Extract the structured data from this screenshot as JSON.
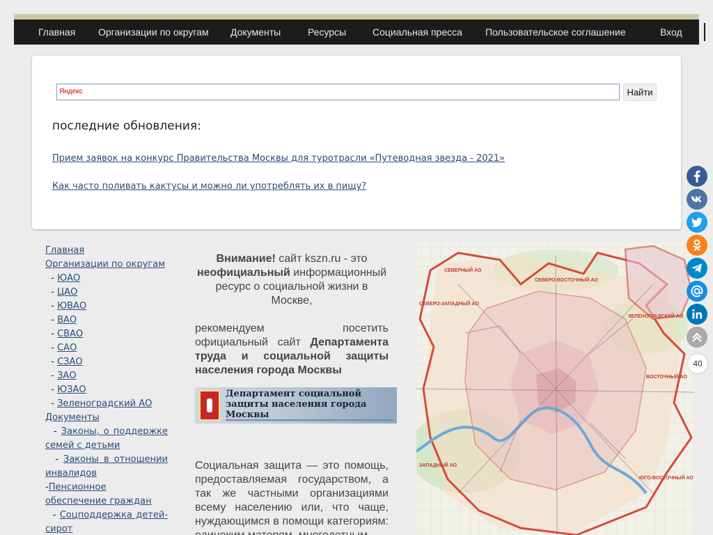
{
  "nav": [
    {
      "id": "home",
      "label": "Главная"
    },
    {
      "id": "orgs",
      "label": "Организации по округам"
    },
    {
      "id": "docs",
      "label": "Документы"
    },
    {
      "id": "resources",
      "label": "Ресурсы"
    },
    {
      "id": "press",
      "label": "Социальная пресса"
    },
    {
      "id": "agreement",
      "label": "Пользовательское соглашение"
    },
    {
      "id": "login",
      "label": "Вход"
    }
  ],
  "search": {
    "placeholder": "Яндекс",
    "button": "Найти"
  },
  "updates": {
    "title": "последние обновления:",
    "links": [
      "Прием заявок на конкурс Правительства Москвы для туротрасли «Путеводная звезда - 2021»",
      "Как часто поливать кактусы и можно ли употреблять их в пищу?"
    ]
  },
  "sidebar": {
    "home": "Главная",
    "orgs": "Организации по округам",
    "districts": [
      "ЮАО",
      "ЦАО",
      "ЮВАО",
      "ВАО",
      "СВАО",
      "САО",
      "СЗАО",
      "ЗАО",
      "ЮЗАО",
      "Зеленоградский АО"
    ],
    "docs": "Документы",
    "doc_links": {
      "family_1": "Законы, о поддержке",
      "family_2": "семей с детьми",
      "disabled_1": "Законы в отношении",
      "disabled_2": "инвалидов",
      "pension_1": "Пенсионное",
      "pension_2": "обеспечение граждан",
      "orphans_1": "Соцподдержка детей-",
      "orphans_2": "сирот"
    }
  },
  "notice": {
    "attention": "Внимание!",
    "text_1": " сайт kszn.ru - это ",
    "unofficial": "неофициальный",
    "text_2": " информационный ресурс о социальной жизни в Москве,",
    "rec_1": "рекомендуем посетить",
    "rec_2": "официальный сайт ",
    "dept": "Департамента труда и социальной защиты населения города Москвы"
  },
  "banner": {
    "text": "Департамент социальной защиты населения города Москвы"
  },
  "paragraph": "Социальная защита — это помощь, предоставляемая государством, а так же частными организациями всему населению или, что чаще, нуждающимся в помощи категориям: одиноким матерям, многодетным",
  "map": {
    "labels": [
      "СЕВЕРНЫЙ АО",
      "СЕВЕРО-ВОСТОЧНЫЙ АО",
      "СЕВЕРО-ЗАПАДНЫЙ АО",
      "ЗЕЛЕНОГРАДСКИЙ АО",
      "ВОСТОЧНЫЙ АО",
      "ЗАПАДНЫЙ АО",
      "ЮГО-ВОСТОЧНЫЙ АО"
    ]
  },
  "share": [
    {
      "name": "facebook",
      "color": "#3b5998"
    },
    {
      "name": "vkontakte",
      "color": "#4c75a3"
    },
    {
      "name": "twitter",
      "color": "#1da1f2"
    },
    {
      "name": "odnoklassniki",
      "color": "#f58220"
    },
    {
      "name": "telegram",
      "color": "#0088cc"
    },
    {
      "name": "mailru",
      "color": "#168de2"
    },
    {
      "name": "linkedin",
      "color": "#0077b5"
    },
    {
      "name": "more",
      "color": "#a9a9a9"
    }
  ],
  "share_count": "40"
}
